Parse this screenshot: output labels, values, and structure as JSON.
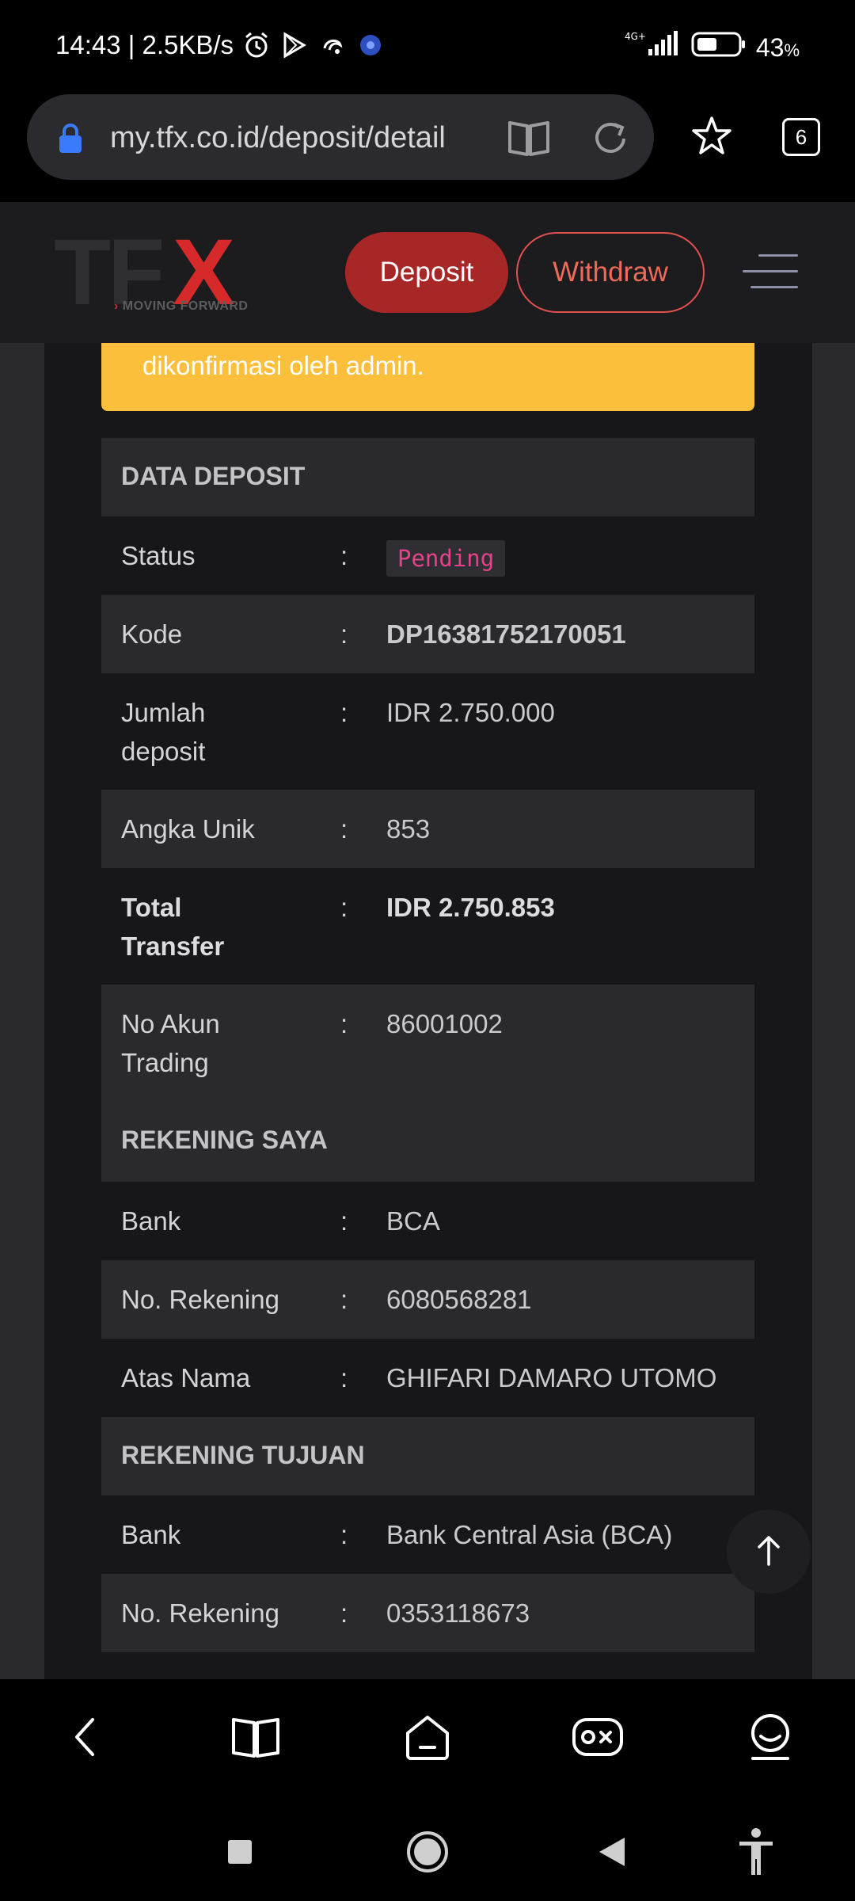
{
  "status_bar": {
    "time_speed": "14:43 | 2.5KB/s",
    "network": "4G+",
    "battery": "43",
    "battery_unit": "%"
  },
  "browser": {
    "url": "my.tfx.co.id/deposit/detail",
    "tab_count": "6"
  },
  "header": {
    "logo_tf": "TF",
    "logo_x": "X",
    "logo_tagline": "MOVING FORWARD",
    "deposit_label": "Deposit",
    "withdraw_label": "Withdraw"
  },
  "alert": {
    "text": "dikonfirmasi oleh admin."
  },
  "data_deposit": {
    "title": "DATA DEPOSIT",
    "status_label": "Status",
    "status_value": "Pending",
    "kode_label": "Kode",
    "kode_value": "DP16381752170051",
    "jumlah_label_1": "Jumlah",
    "jumlah_label_2": "deposit",
    "jumlah_value": "IDR 2.750.000",
    "angka_label": "Angka Unik",
    "angka_value": "853",
    "total_label_1": "Total",
    "total_label_2": "Transfer",
    "total_value": "IDR 2.750.853",
    "akun_label_1": "No Akun",
    "akun_label_2": "Trading",
    "akun_value": "86001002"
  },
  "rekening_saya": {
    "title": "REKENING SAYA",
    "bank_label": "Bank",
    "bank_value": "BCA",
    "norek_label": "No. Rekening",
    "norek_value": "6080568281",
    "nama_label": "Atas Nama",
    "nama_value": "GHIFARI DAMARO UTOMO"
  },
  "rekening_tujuan": {
    "title": "REKENING TUJUAN",
    "bank_label": "Bank",
    "bank_value": "Bank Central Asia (BCA)",
    "norek_label": "No. Rekening",
    "norek_value": "0353118673"
  },
  "colon": ":",
  "colors": {
    "deposit_button": "#a72626",
    "alert": "#fbbf3c",
    "kode": "#f0574d",
    "pending": "#e4438a"
  },
  "icons": {
    "lock": "lock-icon",
    "reader": "book-icon",
    "reload": "reload-icon",
    "star": "star-icon",
    "scroll_top": "arrow-up-icon",
    "back": "chevron-left-icon",
    "book": "book-icon",
    "home": "home-icon",
    "games": "gamepad-icon",
    "profile": "user-icon"
  }
}
